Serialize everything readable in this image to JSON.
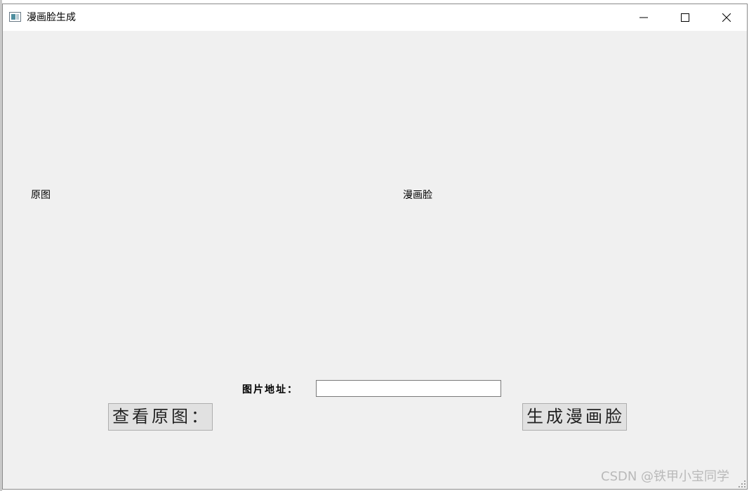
{
  "window": {
    "title": "漫画脸生成"
  },
  "titlebar": {
    "icons": [
      "app-window-icon",
      "minimize-icon",
      "maximize-icon",
      "close-icon"
    ]
  },
  "labels": {
    "original": "原图",
    "cartoon": "漫画脸",
    "image_path": "图片地址："
  },
  "input": {
    "image_path_value": ""
  },
  "buttons": {
    "view_original": "查看原图：",
    "generate": "生成漫画脸"
  },
  "watermark": "CSDN @铁甲小宝同学",
  "colors": {
    "window_bg": "#f0f0f0",
    "titlebar_bg": "#ffffff",
    "button_bg": "#e1e1e1"
  }
}
